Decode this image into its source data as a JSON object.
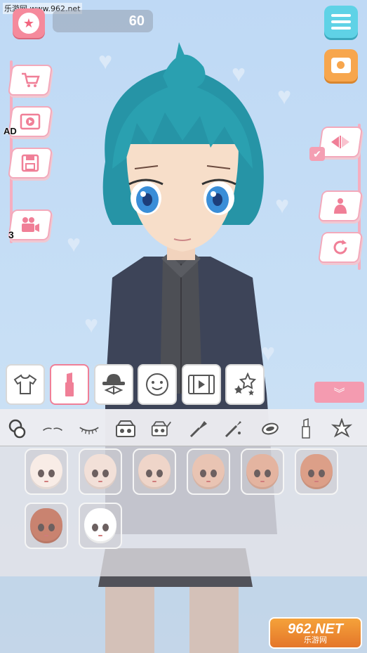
{
  "watermark": "乐游网 www.962.net",
  "score": "60",
  "ad_label": "AD",
  "video_count": "3",
  "side_left": [
    {
      "name": "shop",
      "icon": "shopping-cart-icon"
    },
    {
      "name": "ad-video",
      "icon": "play-video-icon"
    },
    {
      "name": "save",
      "icon": "floppy-disk-icon"
    },
    {
      "name": "video-camera",
      "icon": "video-camera-icon"
    }
  ],
  "side_right": [
    {
      "name": "flip",
      "icon": "flip-arrows-icon"
    },
    {
      "name": "pose",
      "icon": "pose-figure-icon"
    },
    {
      "name": "reset",
      "icon": "rotate-icon"
    }
  ],
  "tabs": [
    {
      "name": "clothes",
      "icon": "shirt-icon",
      "active": false
    },
    {
      "name": "makeup",
      "icon": "lipstick-icon",
      "active": true
    },
    {
      "name": "accessories",
      "icon": "hat-icon",
      "active": false
    },
    {
      "name": "face",
      "icon": "smiley-face-icon",
      "active": false
    },
    {
      "name": "video",
      "icon": "film-play-icon",
      "active": false
    },
    {
      "name": "effects",
      "icon": "stars-icon",
      "active": false
    }
  ],
  "subcategories": [
    "skin",
    "eyebrows",
    "eyelashes",
    "eyeshadow",
    "blush",
    "brush",
    "eyeliner",
    "powder",
    "lipstick",
    "face-sticker"
  ],
  "skin_tones": [
    "#f8ece6",
    "#f2e0d8",
    "#efd5c9",
    "#e9c4b3",
    "#e4b4a0",
    "#dc9f88",
    "#c98370",
    "#ffffff"
  ],
  "colors": {
    "accent_pink": "#f07f97",
    "menu_cyan": "#5fd2e6",
    "camera_orange": "#f7a64d",
    "hair": "#2aa0b0"
  },
  "logo": {
    "main": "962.NET",
    "sub": "乐游网"
  }
}
